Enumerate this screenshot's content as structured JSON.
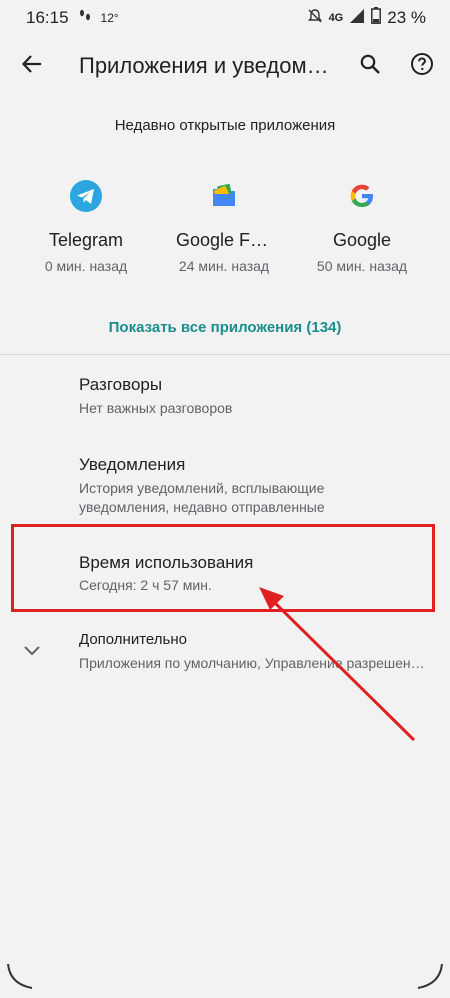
{
  "status_bar": {
    "time": "16:15",
    "temperature": "12°",
    "network": "4G",
    "battery": "23 %"
  },
  "app_bar": {
    "title": "Приложения и уведомления",
    "back_icon": "arrow-back-icon",
    "search_icon": "search-icon",
    "help_icon": "help-icon"
  },
  "recent": {
    "heading": "Недавно открытые приложения",
    "apps": [
      {
        "name": "Telegram",
        "time": "0 мин. назад",
        "icon": "telegram-icon"
      },
      {
        "name": "Google Files",
        "time": "24 мин. назад",
        "icon": "google-files-icon"
      },
      {
        "name": "Google",
        "time": "50 мин. назад",
        "icon": "google-icon"
      }
    ],
    "show_all": "Показать все приложения (134)"
  },
  "settings": {
    "items": [
      {
        "title": "Разговоры",
        "summary": "Нет важных разговоров"
      },
      {
        "title": "Уведомления",
        "summary": "История уведомлений, всплывающие уведомления, недавно отправленные"
      },
      {
        "title": "Время использования",
        "summary": "Сегодня: 2 ч 57 мин."
      },
      {
        "title": "Дополнительно",
        "summary": "Приложения по умолчанию, Управление разрешениями"
      }
    ]
  },
  "colors": {
    "accent": "#1a8e8c",
    "annotation": "#e02020",
    "telegram": "#2ca5e0"
  }
}
